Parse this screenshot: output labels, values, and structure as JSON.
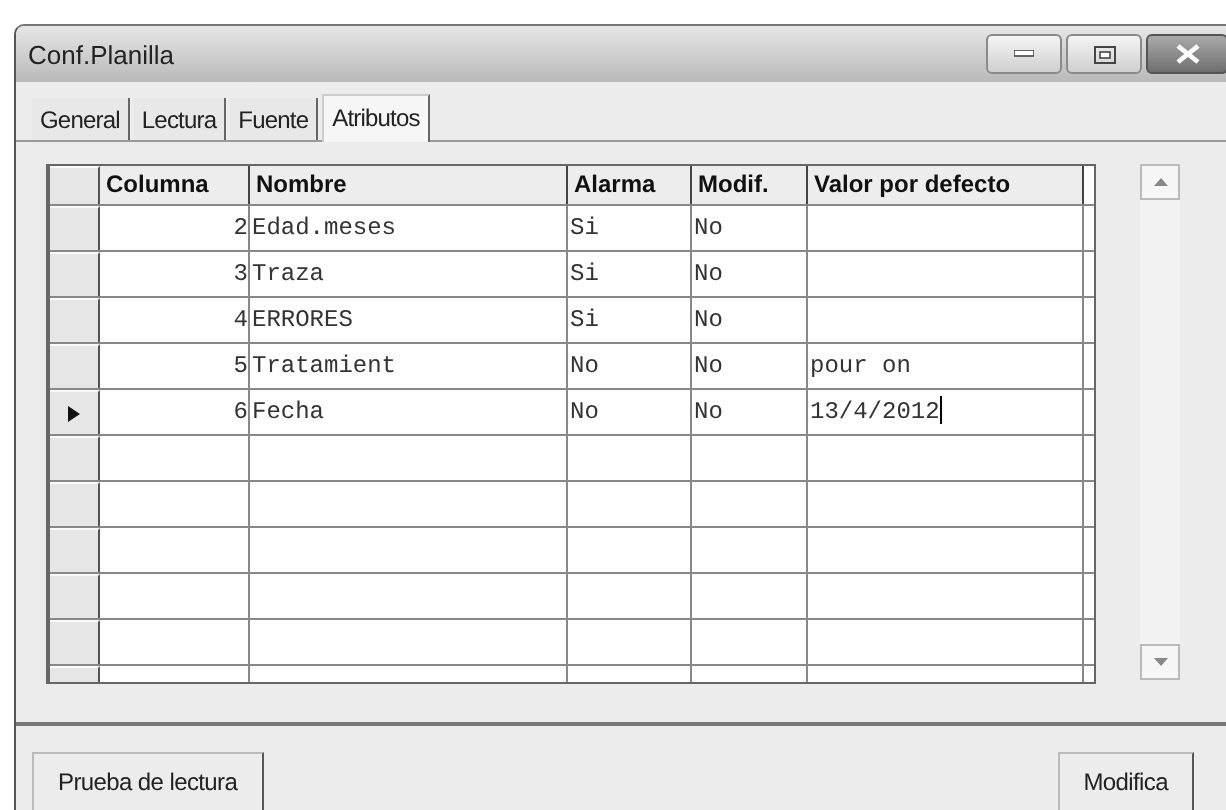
{
  "window": {
    "title": "Conf.Planilla"
  },
  "tabs": [
    {
      "label": "General",
      "selected": false
    },
    {
      "label": "Lectura",
      "selected": false
    },
    {
      "label": "Fuente",
      "selected": false
    },
    {
      "label": "Atributos",
      "selected": true
    }
  ],
  "table": {
    "columns": [
      "Columna",
      "Nombre",
      "Alarma",
      "Modif.",
      "Valor por defecto"
    ],
    "rows": [
      {
        "cells": [
          "2",
          "Edad.meses",
          "Si",
          "No",
          ""
        ],
        "selected": false
      },
      {
        "cells": [
          "3",
          "Traza",
          "Si",
          "No",
          ""
        ],
        "selected": false
      },
      {
        "cells": [
          "4",
          "ERRORES",
          "Si",
          "No",
          ""
        ],
        "selected": false
      },
      {
        "cells": [
          "5",
          "Tratamient",
          "No",
          "No",
          "pour on"
        ],
        "selected": false
      },
      {
        "cells": [
          "6",
          "Fecha",
          "No",
          "No",
          "13/4/2012"
        ],
        "selected": true
      }
    ]
  },
  "buttons": [
    "Prueba de lectura",
    "Modifica"
  ]
}
